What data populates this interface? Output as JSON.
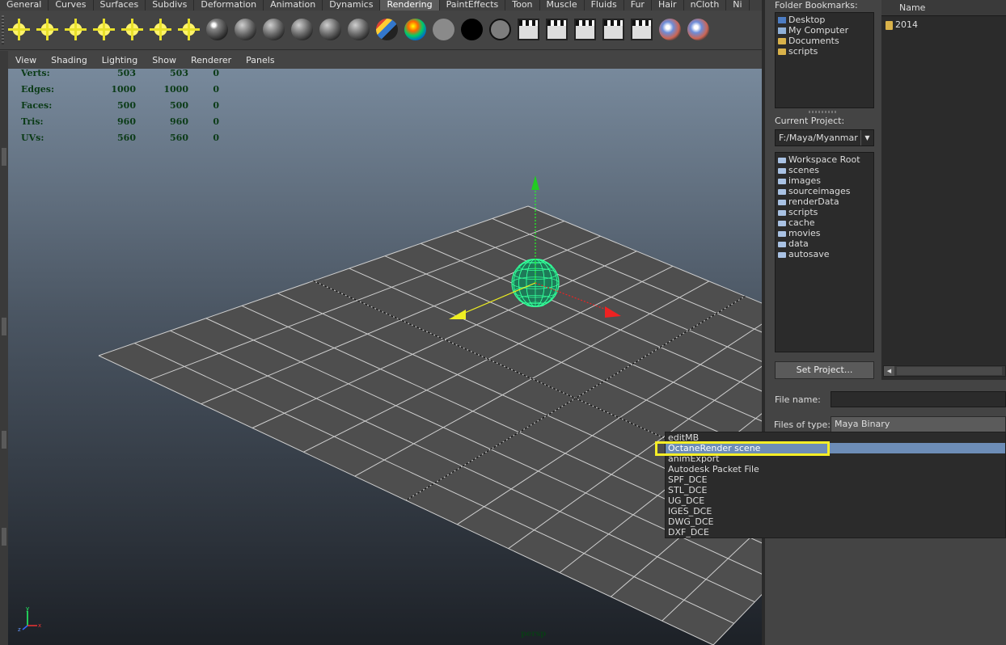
{
  "shelf_tabs": [
    "General",
    "Curves",
    "Surfaces",
    "Subdivs",
    "Deformation",
    "Animation",
    "Dynamics",
    "Rendering",
    "PaintEffects",
    "Toon",
    "Muscle",
    "Fluids",
    "Fur",
    "Hair",
    "nCloth",
    "Ni"
  ],
  "active_tab": "Rendering",
  "shelf_icons": [
    "ambient-light-icon",
    "directional-light-icon",
    "point-light-icon",
    "spot-light-icon",
    "area-light-icon",
    "volume-light-icon",
    "camera-icon",
    "render-sphere-icon",
    "lambert-sphere-icon",
    "blinn-sphere-icon",
    "phong-sphere-icon",
    "phonge-sphere-icon",
    "anisotropic-sphere-icon",
    "ramp-sphere-icon",
    "layered-sphere-icon",
    "surface-shader-icon",
    "use-background-icon",
    "ring-sphere-icon",
    "render-view-icon",
    "render-current-icon",
    "ipr-render-icon",
    "batch-render-icon",
    "render-settings-icon",
    "hypershade-icon",
    "paint-effects-icon"
  ],
  "panel_menu": [
    "View",
    "Shading",
    "Lighting",
    "Show",
    "Renderer",
    "Panels"
  ],
  "hud": [
    {
      "label": "Verts:",
      "v1": "503",
      "v2": "503",
      "v3": "0"
    },
    {
      "label": "Edges:",
      "v1": "1000",
      "v2": "1000",
      "v3": "0"
    },
    {
      "label": "Faces:",
      "v1": "500",
      "v2": "500",
      "v3": "0"
    },
    {
      "label": "Tris:",
      "v1": "960",
      "v2": "960",
      "v3": "0"
    },
    {
      "label": "UVs:",
      "v1": "560",
      "v2": "560",
      "v3": "0"
    }
  ],
  "camera_label": "persp",
  "axis": {
    "y": "y",
    "x": "x",
    "z": "z"
  },
  "browser": {
    "bookmarks_label": "Folder Bookmarks:",
    "bookmarks": [
      "Desktop",
      "My Computer",
      "Documents",
      "scripts"
    ],
    "current_project_label": "Current Project:",
    "current_project": "F:/Maya/Myanmar",
    "project_folders": [
      "Workspace Root",
      "scenes",
      "images",
      "sourceimages",
      "renderData",
      "scripts",
      "cache",
      "movies",
      "data",
      "autosave"
    ],
    "set_project_button": "Set Project...",
    "name_header": "Name",
    "files": [
      "2014"
    ],
    "file_name_label": "File name:",
    "file_name_value": "",
    "files_of_type_label": "Files of type:",
    "files_of_type_value": "Maya Binary"
  },
  "dropdown": {
    "options": [
      "editMB",
      "OctaneRender scene",
      "animExport",
      "Autodesk Packet File",
      "SPF_DCE",
      "STL_DCE",
      "UG_DCE",
      "IGES_DCE",
      "DWG_DCE",
      "DXF_DCE"
    ],
    "highlighted": "OctaneRender scene"
  },
  "colors": {
    "highlight": "#f6ee27",
    "selection": "#6d8db7",
    "hud_text": "#0b3b17",
    "sphere_wire": "#33ff99"
  }
}
